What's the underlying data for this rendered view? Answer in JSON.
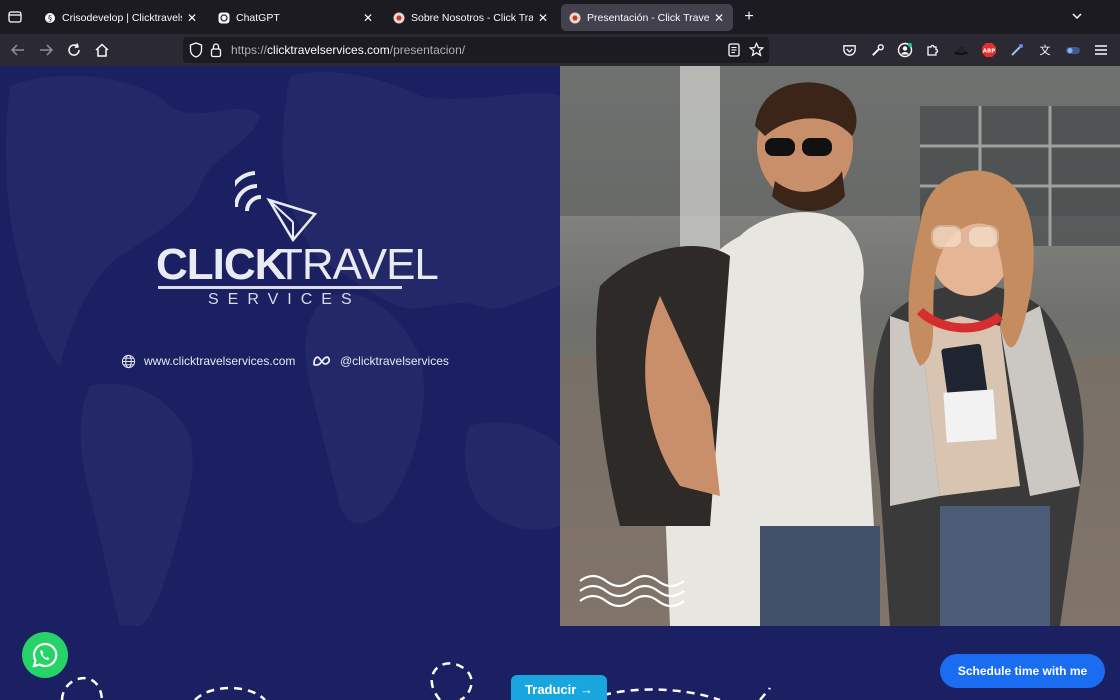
{
  "browser": {
    "tabs": [
      {
        "title": "Crisodevelop | Clicktravelservice",
        "favicon": "wordpress-icon",
        "active": false
      },
      {
        "title": "ChatGPT",
        "favicon": "chatgpt-icon",
        "active": false
      },
      {
        "title": "Sobre Nosotros - Click Travel Se",
        "favicon": "site-icon",
        "active": false
      },
      {
        "title": "Presentación - Click Travel Serv",
        "favicon": "site-icon",
        "active": true
      }
    ],
    "url": {
      "scheme": "https://",
      "host": "clicktravelservices.com",
      "path": "/presentacion/"
    }
  },
  "hero": {
    "logo": {
      "word1": "CLICK",
      "word2": "TRAVEL",
      "subtitle": "SERVICES"
    },
    "website": "www.clicktravelservices.com",
    "social": "@clicktravelservices"
  },
  "widgets": {
    "schedule_label": "Schedule time with me",
    "translate_label": "Traducir →"
  },
  "colors": {
    "page_bg": "#1b2062",
    "whatsapp": "#25d366",
    "schedule": "#1a6df0",
    "translate": "#19a6df"
  }
}
